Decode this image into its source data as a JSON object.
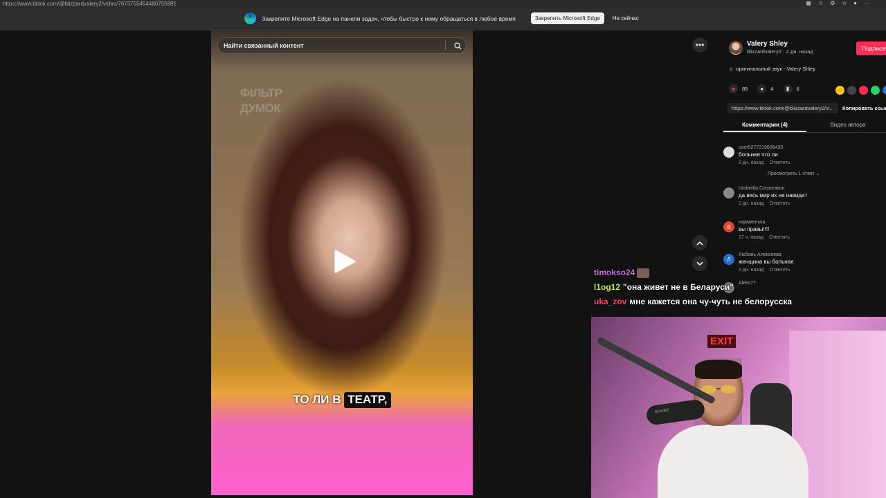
{
  "browser": {
    "url": "https://www.tiktok.com/@blizzardvalery2/video/7673755454480755981"
  },
  "edge_banner": {
    "message": "Закрепите Microsoft Edge на панели задач, чтобы быстро к нему обращаться в любое время",
    "pin_button": "Закрепить Microsoft Edge",
    "dismiss_button": "Не сейчас"
  },
  "video": {
    "search_placeholder": "Найти связанный контент",
    "watermark_line1": "ФІЛЬТР",
    "watermark_line2": "ДУМОК",
    "subtitle_plain": "ТО ЛИ В",
    "subtitle_highlight": "ТЕАТР,"
  },
  "author": {
    "name": "Valery Shley",
    "handle_time": "blizzardvalery2 · 2 дн. назад",
    "follow_label": "Подписаться",
    "sound": "оригинальный звук - Valery Shley"
  },
  "stats": {
    "likes": "85",
    "comments": "4",
    "saves": "6"
  },
  "link": {
    "url": "https://www.tiktok.com/@blizzardvalery2/vi...",
    "copy_label": "Копировать ссылку"
  },
  "tabs": [
    {
      "label": "Комментарии (4)"
    },
    {
      "label": "Видео автора"
    }
  ],
  "comments": [
    {
      "user": "user9277219606430",
      "text": "больная что ли",
      "time": "2 дн. назад",
      "reply": "Ответить",
      "avatar_letter": ""
    },
    {
      "user": "Umbrella.Corporation",
      "text": "да весь мир их не навидит",
      "time": "2 дн. назад",
      "reply": "Ответить",
      "avatar_letter": ""
    },
    {
      "user": "карамелька",
      "text": "вы правы!!!!",
      "time": "17 ч. назад",
      "reply": "Ответить",
      "avatar_letter": "В"
    },
    {
      "user": "Любовь Алексеева",
      "text": "женщина вы больная",
      "time": "2 дн. назад",
      "reply": "Ответить",
      "avatar_letter": "Л"
    },
    {
      "user": "Aleks77",
      "text": "",
      "time": "",
      "reply": "",
      "avatar_letter": ""
    }
  ],
  "view_replies": "Просмотреть 1 ответ",
  "chat": [
    {
      "user": "timokso24",
      "message": ""
    },
    {
      "user": "l1og12",
      "message": "\"она живет не в Беларуси\""
    },
    {
      "user": "uka_zov",
      "message": "мне кажется она чу-чуть не белорусска"
    }
  ],
  "webcam": {
    "exit_sign": "EXIT",
    "mic_brand": "SHURE"
  },
  "colors": {
    "accent": "#fe2c55",
    "background": "#121212"
  }
}
